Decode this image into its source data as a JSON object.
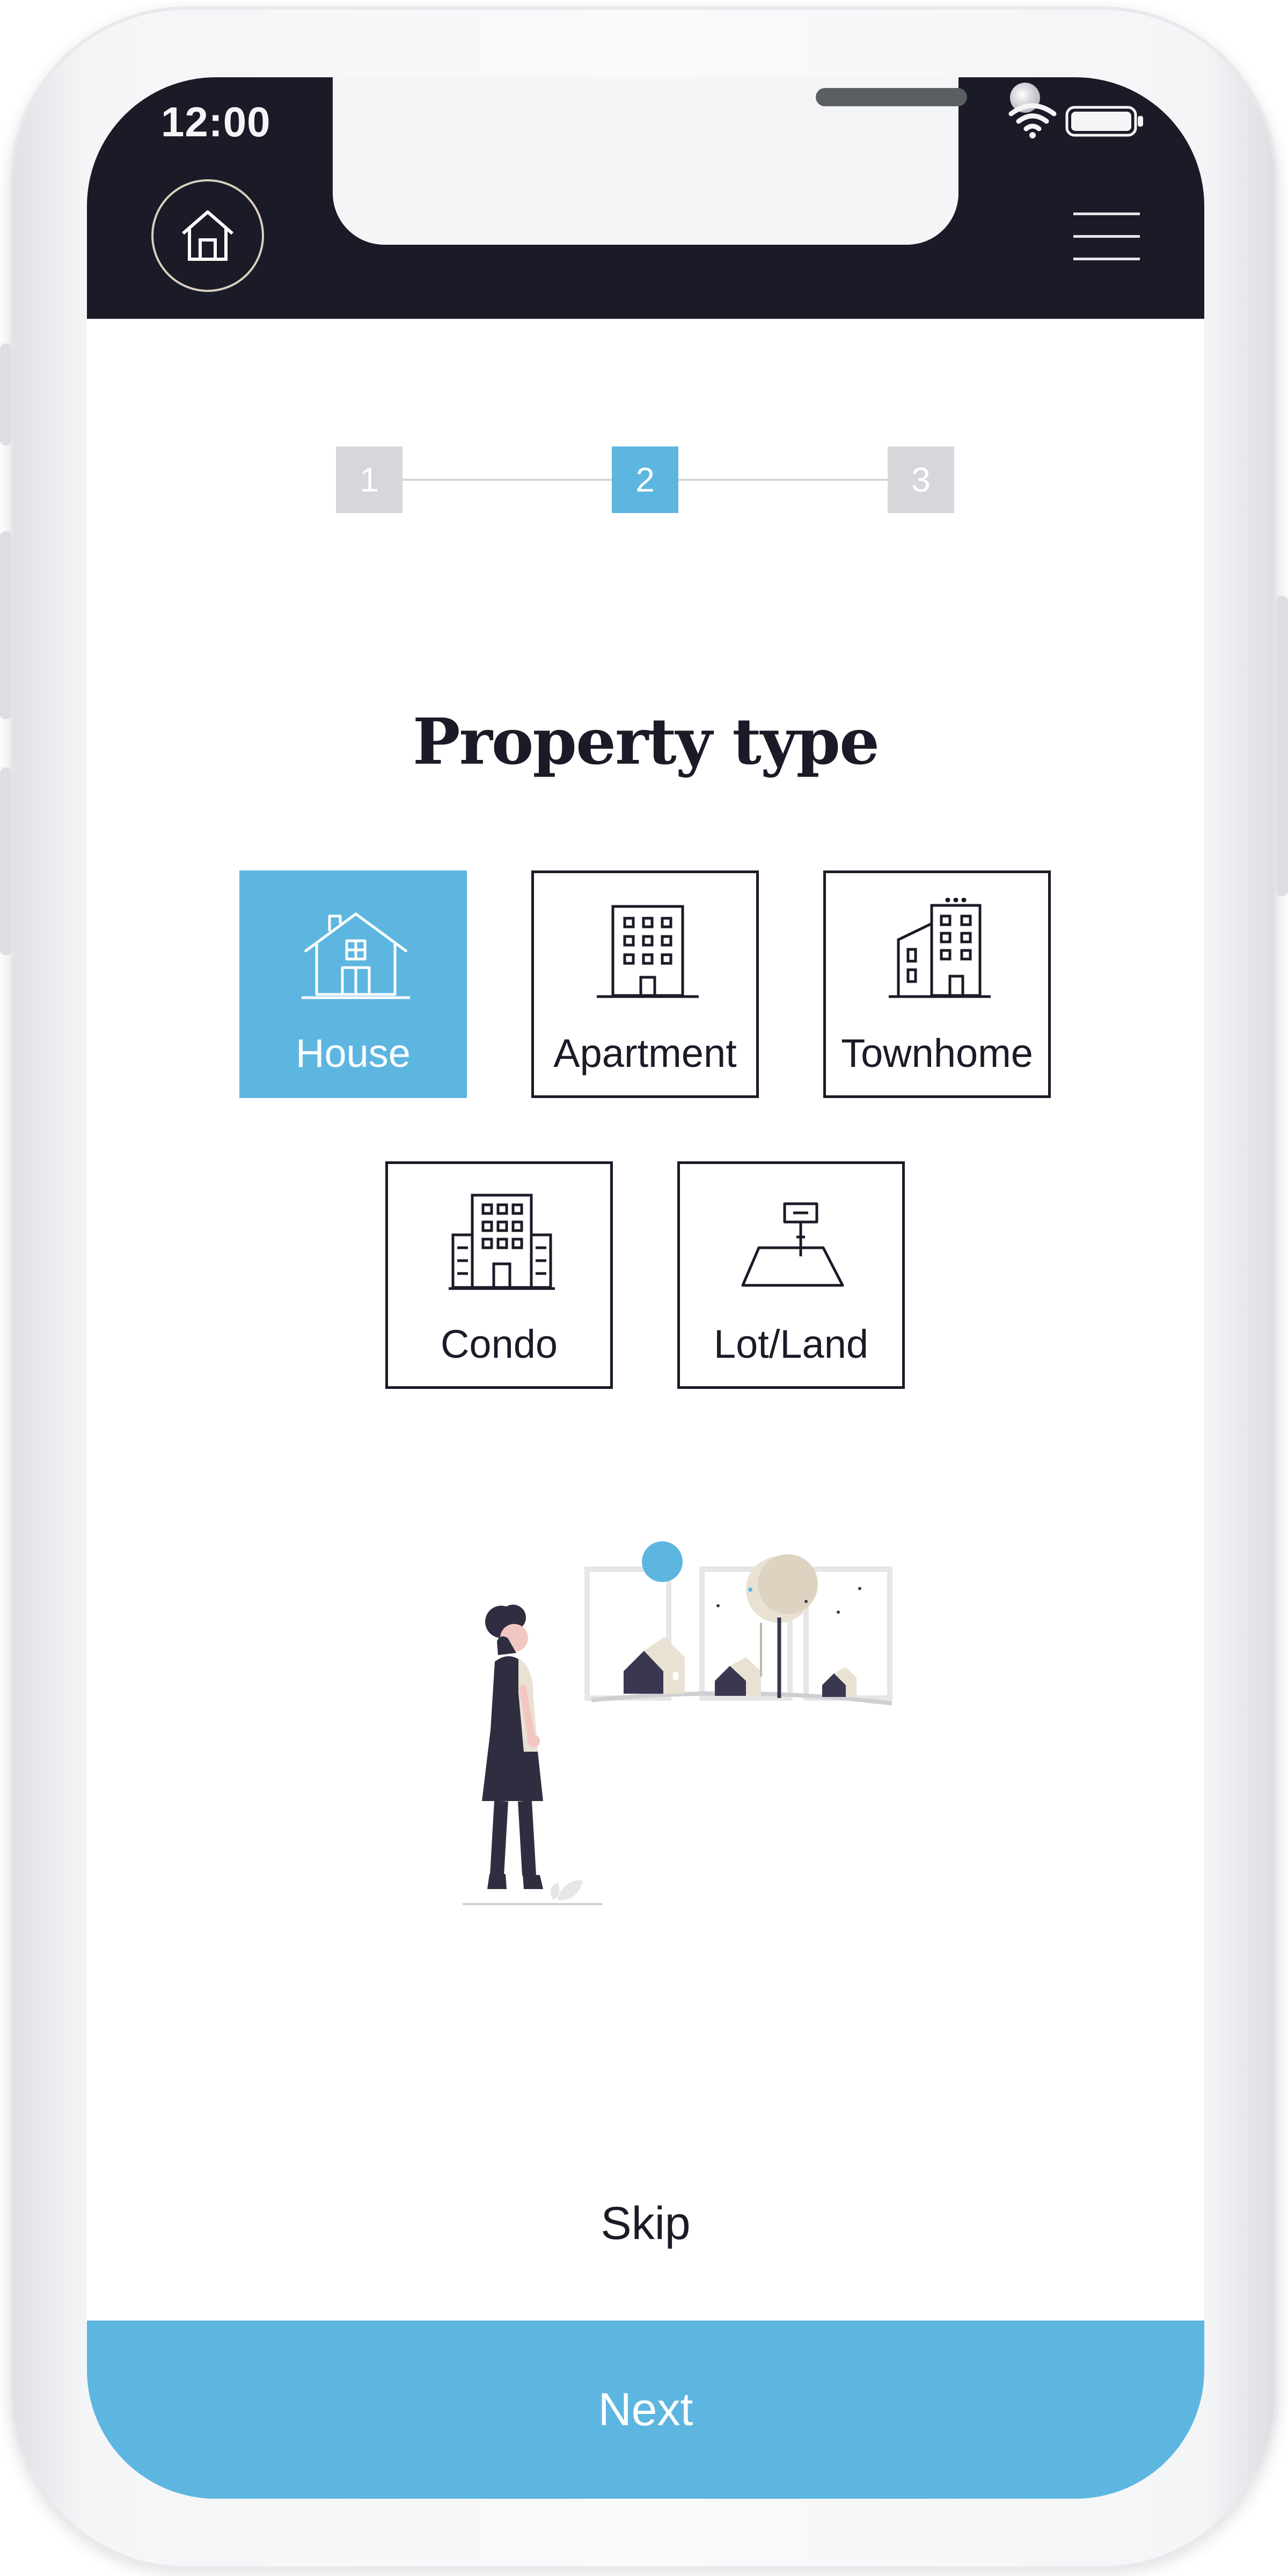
{
  "status_bar": {
    "time": "12:00"
  },
  "header": {
    "home_icon": "home-icon",
    "menu_icon": "hamburger-menu-icon"
  },
  "stepper": {
    "steps": [
      {
        "label": "1"
      },
      {
        "label": "2"
      },
      {
        "label": "3"
      }
    ],
    "current_step": 2
  },
  "title": "Property type",
  "property_types": [
    {
      "label": "House",
      "icon": "house-icon",
      "selected": true
    },
    {
      "label": "Apartment",
      "icon": "apartment-building-icon",
      "selected": false
    },
    {
      "label": "Townhome",
      "icon": "townhome-icon",
      "selected": false
    },
    {
      "label": "Condo",
      "icon": "condo-building-icon",
      "selected": false
    },
    {
      "label": "Lot/Land",
      "icon": "lot-land-icon",
      "selected": false
    }
  ],
  "skip_label": "Skip",
  "next_label": "Next",
  "colors": {
    "accent": "#5db6e0",
    "dark": "#1b1a27",
    "step_inactive": "#d6d7da"
  }
}
